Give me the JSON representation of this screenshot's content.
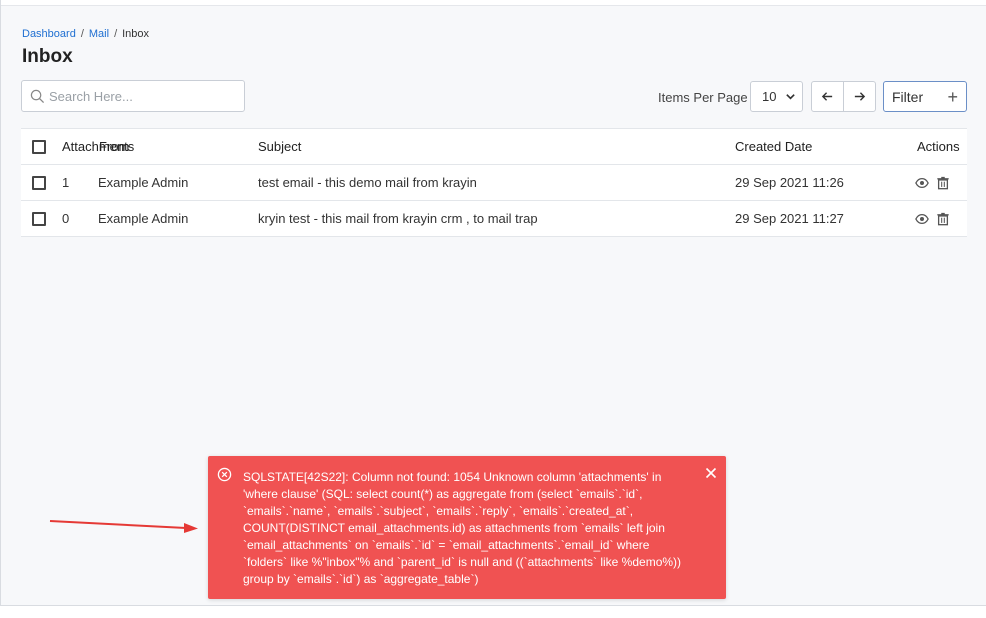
{
  "breadcrumb": {
    "dashboard": "Dashboard",
    "mail": "Mail",
    "separator": "/",
    "current": "Inbox"
  },
  "page_title": "Inbox",
  "search": {
    "placeholder": "Search Here..."
  },
  "pagination": {
    "items_per_page_label": "Items Per Page",
    "items_per_page_value": "10",
    "prev_icon": "arrow-left-icon",
    "next_icon": "arrow-right-icon"
  },
  "filter": {
    "label": "Filter",
    "icon": "plus-icon"
  },
  "table": {
    "headers": {
      "attachments": "Attachments",
      "from": "From",
      "subject": "Subject",
      "created_date": "Created Date",
      "actions": "Actions"
    },
    "rows": [
      {
        "attachments": "1",
        "from": "Example Admin",
        "subject": "test email - this demo mail from krayin",
        "created_date": "29 Sep 2021 11:26"
      },
      {
        "attachments": "0",
        "from": "Example Admin",
        "subject": "kryin test - this mail from krayin crm , to mail trap",
        "created_date": "29 Sep 2021 11:27"
      }
    ],
    "action_icons": [
      "eye-icon",
      "trash-icon"
    ]
  },
  "error_toast": {
    "message": "SQLSTATE[42S22]: Column not found: 1054 Unknown column 'attachments' in 'where clause' (SQL: select count(*) as aggregate from (select `emails`.`id`, `emails`.`name`, `emails`.`subject`, `emails`.`reply`, `emails`.`created_at`, COUNT(DISTINCT email_attachments.id) as attachments from `emails` left join `email_attachments` on `emails`.`id` = `email_attachments`.`email_id` where `folders` like %\"inbox\"% and `parent_id` is null and ((`attachments` like %demo%)) group by `emails`.`id`) as `aggregate_table`)",
    "background": "#f05252"
  },
  "colors": {
    "link": "#1f6fd1",
    "annotation_arrow": "#e53935"
  }
}
